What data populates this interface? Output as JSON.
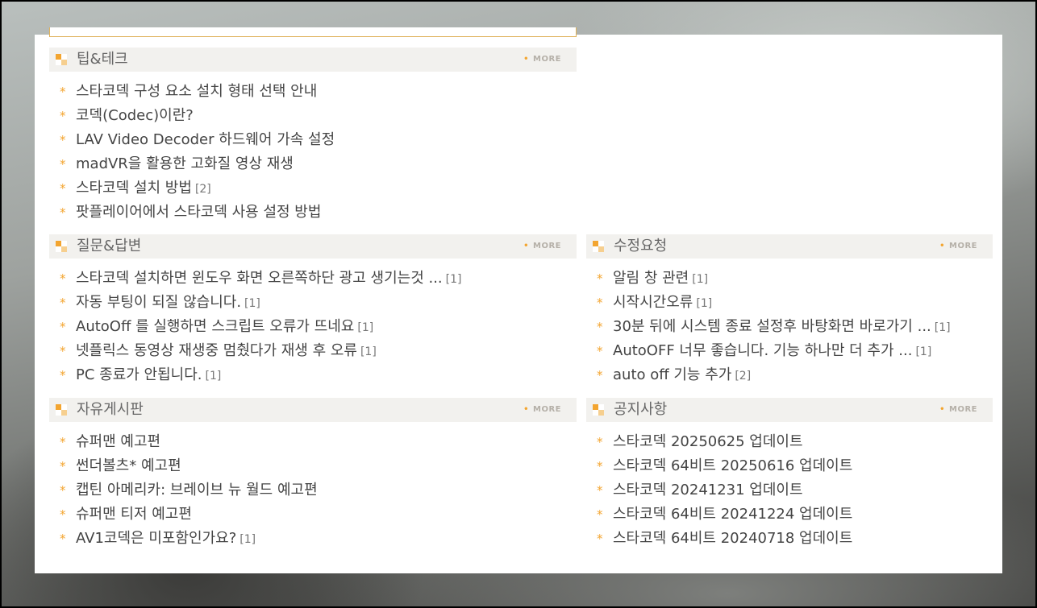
{
  "more_label": "MORE",
  "bullet": "*",
  "sections": [
    {
      "title": "팁&테크",
      "items": [
        {
          "text": "스타코덱 구성 요소 설치 형태 선택 안내",
          "count": ""
        },
        {
          "text": "코덱(Codec)이란?",
          "count": ""
        },
        {
          "text": "LAV Video Decoder 하드웨어 가속 설정",
          "count": ""
        },
        {
          "text": "madVR을 활용한 고화질 영상 재생",
          "count": ""
        },
        {
          "text": "스타코덱 설치 방법",
          "count": "[2]"
        },
        {
          "text": "팟플레이어에서 스타코덱 사용 설정 방법",
          "count": ""
        }
      ]
    },
    {
      "title": "질문&답변",
      "items": [
        {
          "text": "스타코덱 설치하면 윈도우 화면 오른쪽하단 광고 생기는것 ...",
          "count": "[1]"
        },
        {
          "text": "자동 부팅이 되질 않습니다.",
          "count": "[1]"
        },
        {
          "text": "AutoOff 를 실행하면 스크립트 오류가 뜨네요",
          "count": "[1]"
        },
        {
          "text": "넷플릭스 동영상 재생중 멈췄다가 재생 후 오류",
          "count": "[1]"
        },
        {
          "text": "PC 종료가 안됩니다.",
          "count": "[1]"
        }
      ]
    },
    {
      "title": "수정요청",
      "items": [
        {
          "text": "알림 창 관련",
          "count": "[1]"
        },
        {
          "text": "시작시간오류",
          "count": "[1]"
        },
        {
          "text": "30분 뒤에 시스템 종료 설정후 바탕화면 바로가기 ...",
          "count": "[1]"
        },
        {
          "text": "AutoOFF 너무 좋습니다. 기능 하나만 더 추가 ...",
          "count": "[1]"
        },
        {
          "text": "auto off 기능 추가",
          "count": "[2]"
        }
      ]
    },
    {
      "title": "자유게시판",
      "items": [
        {
          "text": "슈퍼맨 예고편",
          "count": ""
        },
        {
          "text": "썬더볼츠* 예고편",
          "count": ""
        },
        {
          "text": "캡틴 아메리카: 브레이브 뉴 월드 예고편",
          "count": ""
        },
        {
          "text": "슈퍼맨 티저 예고편",
          "count": ""
        },
        {
          "text": "AV1코덱은 미포함인가요?",
          "count": "[1]"
        }
      ]
    },
    {
      "title": "공지사항",
      "items": [
        {
          "text": "스타코덱 20250625 업데이트",
          "count": ""
        },
        {
          "text": "스타코덱 64비트 20250616 업데이트",
          "count": ""
        },
        {
          "text": "스타코덱 20241231 업데이트",
          "count": ""
        },
        {
          "text": "스타코덱 64비트 20241224 업데이트",
          "count": ""
        },
        {
          "text": "스타코덱 64비트 20240718 업데이트",
          "count": ""
        }
      ]
    }
  ]
}
